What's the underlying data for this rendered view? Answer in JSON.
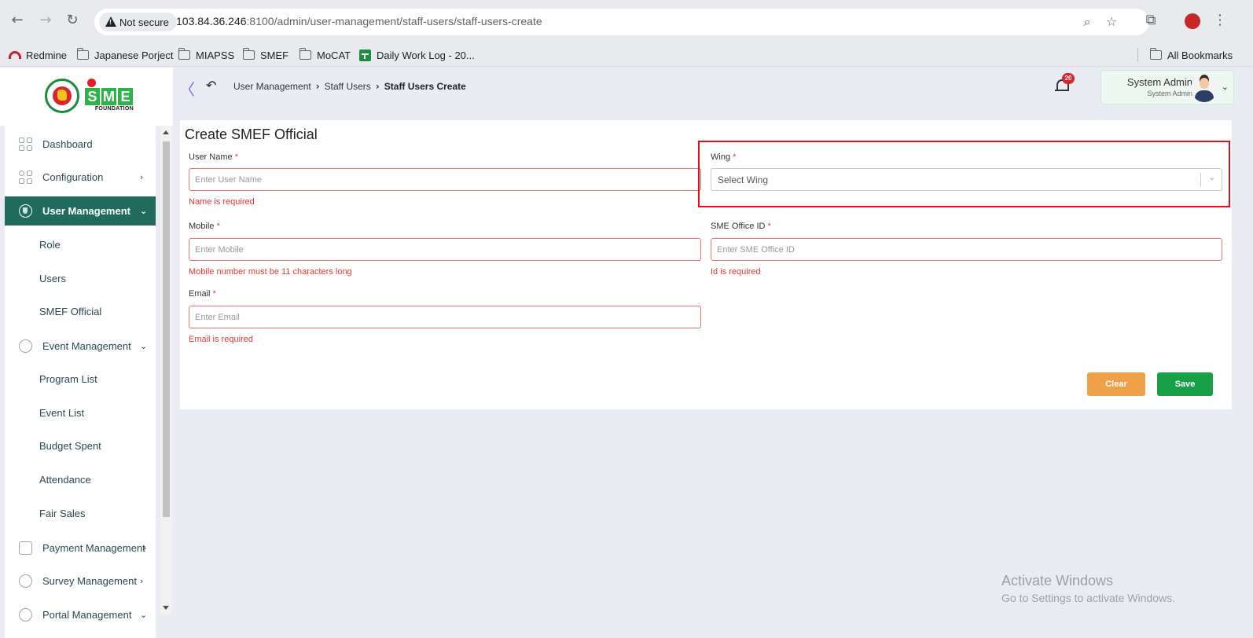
{
  "browser": {
    "security_label": "Not secure",
    "url_host": "103.84.36.246",
    "url_rest": ":8100/admin/user-management/staff-users/staff-users-create",
    "bookmarks": [
      "Redmine",
      "Japanese Porject",
      "MIAPSS",
      "SMEF",
      "MoCAT",
      "Daily Work Log - 20..."
    ],
    "all_bookmarks": "All Bookmarks"
  },
  "logo": {
    "letters": [
      "S",
      "M",
      "E"
    ],
    "tagline": "FOUNDATION"
  },
  "breadcrumb": {
    "items": [
      "User Management",
      "Staff Users",
      "Staff Users Create"
    ]
  },
  "header": {
    "notification_count": "20",
    "user_name": "System Admin",
    "user_role": "System Admin"
  },
  "sidebar": {
    "items": [
      {
        "label": "Dashboard",
        "icon": "grid-icon"
      },
      {
        "label": "Configuration",
        "icon": "config-icon"
      },
      {
        "label": "User Management",
        "icon": "shield-icon"
      },
      {
        "label": "Event Management",
        "icon": "event-icon"
      },
      {
        "label": "Payment Management",
        "icon": "payment-icon"
      },
      {
        "label": "Survey Management",
        "icon": "pie-chart-icon"
      },
      {
        "label": "Portal Management",
        "icon": "portal-icon"
      }
    ],
    "user_management_sub": [
      "Role",
      "Users",
      "SMEF Official"
    ],
    "event_management_sub": [
      "Program List",
      "Event List",
      "Budget Spent",
      "Attendance",
      "Fair Sales"
    ]
  },
  "form": {
    "title": "Create SMEF Official",
    "user_name": {
      "label": "User Name",
      "placeholder": "Enter User Name",
      "error": "Name is required"
    },
    "wing": {
      "label": "Wing",
      "placeholder": "Select Wing"
    },
    "mobile": {
      "label": "Mobile",
      "placeholder": "Enter Mobile",
      "error": "Mobile number must be 11 characters long"
    },
    "office_id": {
      "label": "SME Office ID",
      "placeholder": "Enter SME Office ID",
      "error": "Id is required"
    },
    "email": {
      "label": "Email",
      "placeholder": "Enter Email",
      "error": "Email is required"
    },
    "required_mark": "*",
    "clear_label": "Clear",
    "save_label": "Save"
  },
  "watermark": {
    "line1": "Activate Windows",
    "line2": "Go to Settings to activate Windows."
  },
  "colors": {
    "sidebar_active": "#206b5e",
    "clear_button": "#f0a048",
    "save_button": "#18a048",
    "error": "#e53935",
    "highlight": "#e0101a"
  }
}
